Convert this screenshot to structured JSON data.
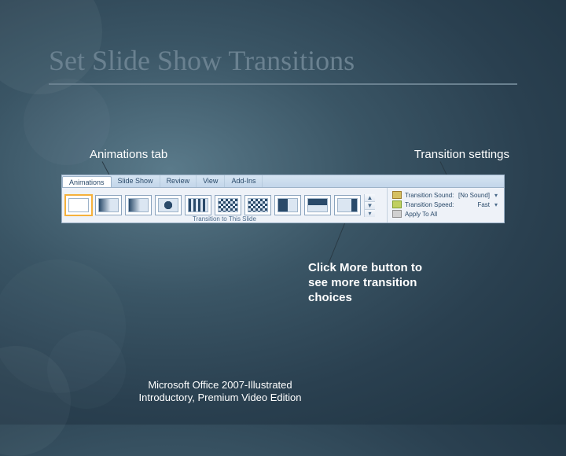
{
  "title": "Set Slide Show Transitions",
  "labels": {
    "animations_tab": "Animations tab",
    "transition_settings": "Transition settings",
    "click_more": "Click More button to see more transition choices"
  },
  "ribbon": {
    "tabs": [
      "Animations",
      "Slide Show",
      "Review",
      "View",
      "Add-Ins"
    ],
    "gallery_caption": "Transition to This Slide",
    "more_up": "▲",
    "more_down": "▼",
    "more_expand": "▾",
    "settings": {
      "sound_label": "Transition Sound:",
      "sound_value": "[No Sound]",
      "speed_label": "Transition Speed:",
      "speed_value": "Fast",
      "apply_all": "Apply To All"
    }
  },
  "footer": "Microsoft Office 2007-Illustrated Introductory, Premium Video Edition"
}
